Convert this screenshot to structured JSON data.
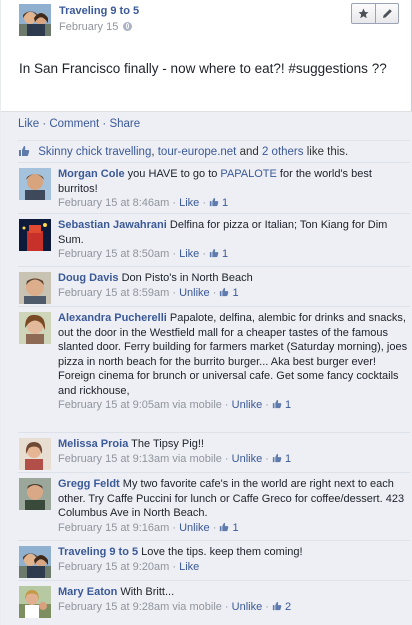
{
  "post": {
    "author": "Traveling 9 to 5",
    "date": "February 15",
    "status_text": "In San Francisco finally - now where to eat?! #suggestions ??",
    "header_buttons": [
      "star-icon",
      "pencil-icon"
    ]
  },
  "actions": {
    "like": "Like",
    "comment": "Comment",
    "share": "Share",
    "sep": "·"
  },
  "likes_line": {
    "name1": "Skinny chick travelling",
    "sep1": ", ",
    "name2": "tour-europe.net",
    "mid": " and ",
    "others": "2 others",
    "tail": " like this."
  },
  "comments": [
    {
      "name": "Morgan Cole",
      "text_before": " you HAVE to go to ",
      "text_link": "PAPALOTE",
      "text_after": " for the world's best burritos!",
      "timestamp": "February 15 at 8:46am",
      "via": "",
      "like_action": "Like",
      "like_count": "1"
    },
    {
      "name": "Sebastian Jawahrani",
      "text": " Delfina for pizza or Italian; Ton Kiang for Dim Sum.",
      "timestamp": "February 15 at 8:50am",
      "via": "",
      "like_action": "Like",
      "like_count": "1"
    },
    {
      "name": "Doug Davis",
      "text": " Don Pisto's in North Beach",
      "timestamp": "February 15 at 8:59am",
      "via": "",
      "like_action": "Unlike",
      "like_count": "1"
    },
    {
      "name": "Alexandra Pucherelli",
      "text": " Papalote, delfina, alembic for drinks and snacks, out the door in the Westfield mall for a cheaper tastes of the famous slanted door. Ferry building for farmers market (Saturday morning), joes pizza in north beach for the burrito burger... Aka best burger ever! Foreign cinema for brunch or universal cafe. Get some fancy cocktails and rickhouse,",
      "timestamp": "February 15 at 9:05am",
      "via": " via mobile",
      "like_action": "Unlike",
      "like_count": "1"
    },
    {
      "name": "Melissa Proia",
      "text": " The Tipsy Pig!!",
      "timestamp": "February 15 at 9:13am",
      "via": " via mobile",
      "like_action": "Unlike",
      "like_count": "1"
    },
    {
      "name": "Gregg Feldt",
      "text": " My two favorite cafe's in the world are right next to each other. Try Caffe Puccini for lunch or Caffe Greco for coffee/dessert. 423 Columbus Ave in North Beach.",
      "timestamp": "February 15 at 9:16am",
      "via": "",
      "like_action": "Unlike",
      "like_count": "1"
    },
    {
      "name": "Traveling 9 to 5",
      "text": " Love the tips. keep them coming!",
      "timestamp": "February 15 at 9:20am",
      "via": "",
      "like_action": "Like",
      "like_count": ""
    },
    {
      "name": "Mary Eaton",
      "text": " With Britt...",
      "timestamp": "February 15 at 9:28am",
      "via": " via mobile",
      "like_action": "Unlike",
      "like_count": "2"
    }
  ],
  "meta_sep": " · "
}
